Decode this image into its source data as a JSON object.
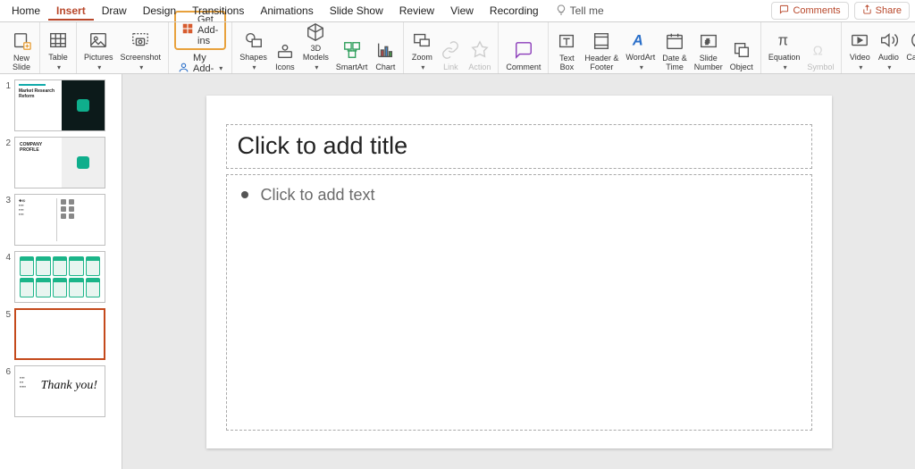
{
  "tabs": {
    "items": [
      "Home",
      "Insert",
      "Draw",
      "Design",
      "Transitions",
      "Animations",
      "Slide Show",
      "Review",
      "View",
      "Recording"
    ],
    "active": "Insert",
    "tell_me": "Tell me"
  },
  "top_right": {
    "comments": "Comments",
    "share": "Share"
  },
  "ribbon": {
    "new_slide": "New\nSlide",
    "table": "Table",
    "pictures": "Pictures",
    "screenshot": "Screenshot",
    "get_addins": "Get Add-ins",
    "my_addins": "My Add-ins",
    "shapes": "Shapes",
    "icons": "Icons",
    "models_3d": "3D\nModels",
    "smartart": "SmartArt",
    "chart": "Chart",
    "zoom": "Zoom",
    "link": "Link",
    "action": "Action",
    "comment": "Comment",
    "text_box": "Text\nBox",
    "header_footer": "Header &\nFooter",
    "wordart": "WordArt",
    "date_time": "Date &\nTime",
    "slide_number": "Slide\nNumber",
    "object": "Object",
    "equation": "Equation",
    "symbol": "Symbol",
    "video": "Video",
    "audio": "Audio",
    "cameo": "Cameo"
  },
  "thumbs": {
    "count": 6,
    "selected": 5,
    "slide1": {
      "title": "Market Research\nReform"
    },
    "slide2": {
      "title": "COMPANY PROFILE"
    },
    "slide6": {
      "thanks": "Thank you!"
    }
  },
  "slide": {
    "title_placeholder": "Click to add title",
    "body_placeholder": "Click to add text"
  }
}
